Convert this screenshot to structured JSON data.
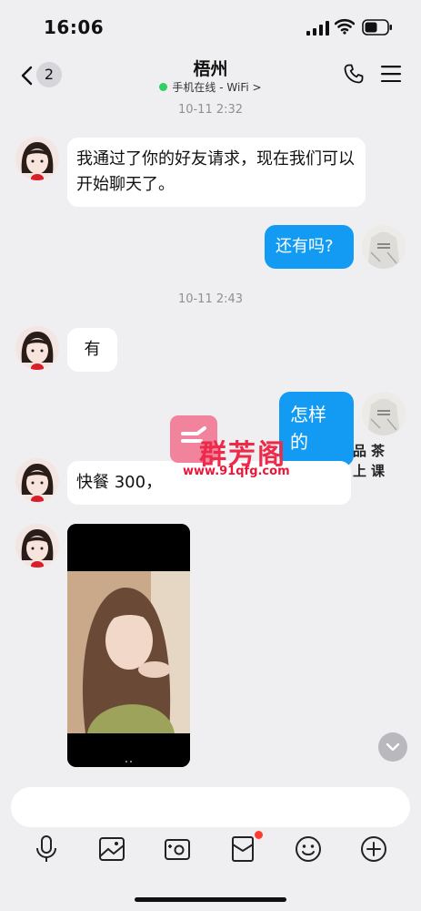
{
  "status_bar": {
    "time": "16:06"
  },
  "header": {
    "unread_count": "2",
    "title": "梧州",
    "online_status": "手机在线 - WiFi >"
  },
  "messages": {
    "timestamp_1": "10-11 2:32",
    "msg_1": "我通过了你的好友请求，现在我们可以开始聊天了。",
    "msg_2": "还有吗?",
    "timestamp_2": "10-11 2:43",
    "msg_3": "有",
    "msg_4": "怎样的",
    "msg_5": "快餐 300，"
  },
  "watermark": {
    "brand": "群芳阁",
    "url": "www.91qfg.com",
    "tag_line_1": "品茶",
    "tag_line_2": "上课"
  },
  "input": {
    "placeholder": ""
  },
  "colors": {
    "outgoing_bubble": "#139bf4",
    "incoming_bubble": "#ffffff",
    "background": "#efeff1",
    "online_dot": "#2fcf62",
    "notification_dot": "#ff3b30"
  },
  "icons": {
    "back": "chevron-left-icon",
    "phone": "phone-icon",
    "menu": "hamburger-menu-icon",
    "voice": "microphone-icon",
    "image": "image-icon",
    "camera": "camera-icon",
    "red_packet": "red-packet-icon",
    "emoji": "emoji-icon",
    "plus": "plus-icon",
    "scroll_down": "chevron-down-icon"
  }
}
